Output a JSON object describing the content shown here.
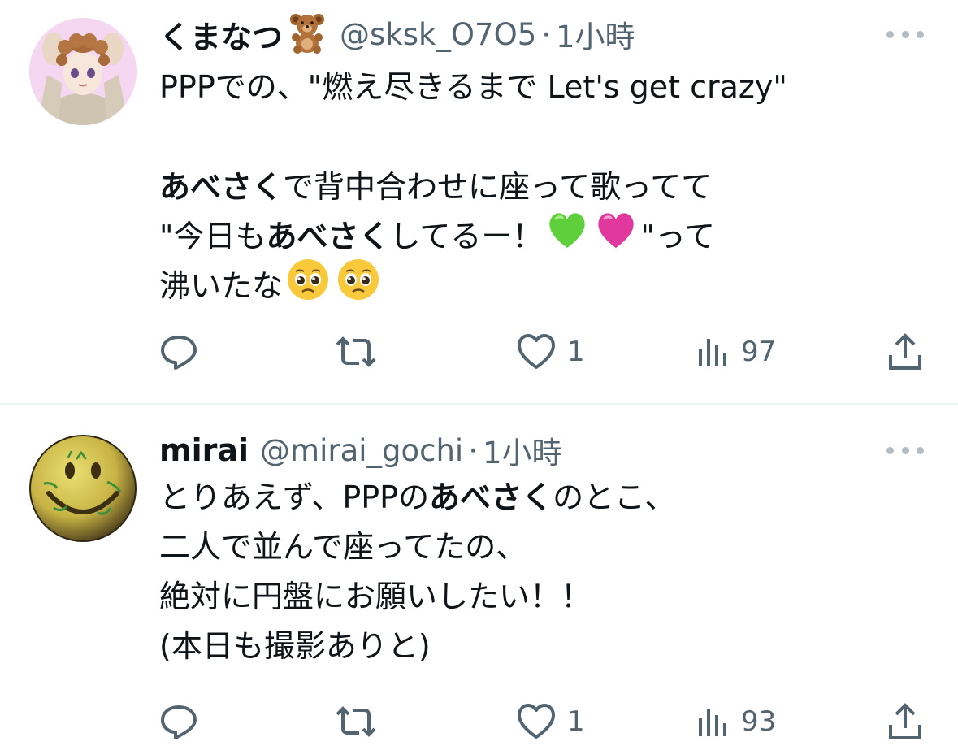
{
  "tweets": [
    {
      "author": {
        "name": "くまなつ",
        "name_emoji": "teddy-bear",
        "handle": "@sksk_O7O5",
        "dot": "·",
        "time": "1小時"
      },
      "body": {
        "l1": "PPPでの、\"燃え尽きるまで Let's get crazy\"",
        "l3_bold": "あべさく",
        "l3_rest": "で背中合わせに座って歌ってて",
        "l4_pre": "\"今日も",
        "l4_bold": "あべさく",
        "l4_post": "してるー！",
        "l4_tail": "\"って",
        "l5": "沸いたな",
        "l4_emojis": [
          "green-heart",
          "pink-heart"
        ],
        "l5_emojis": [
          "pleading-face",
          "pleading-face"
        ]
      },
      "stats": {
        "replies": "",
        "retweets": "",
        "likes": "1",
        "views": "97"
      }
    },
    {
      "author": {
        "name": "mirai",
        "handle": "@mirai_gochi",
        "dot": "·",
        "time": "1小時"
      },
      "body": {
        "l1_pre": "とりあえず、PPPの",
        "l1_bold": "あべさく",
        "l1_post": "のとこ、",
        "l2": "二人で並んで座ってたの、",
        "l3": "絶対に円盤にお願いしたい！！",
        "l4": "(本日も撮影ありと)"
      },
      "stats": {
        "replies": "",
        "retweets": "",
        "likes": "1",
        "views": "93"
      }
    }
  ],
  "colors": {
    "text": "#0f1419",
    "muted": "#536471",
    "divider": "#eff3f4"
  },
  "icons": [
    "reply-icon",
    "retweet-icon",
    "like-icon",
    "views-icon",
    "share-icon",
    "more-icon"
  ]
}
